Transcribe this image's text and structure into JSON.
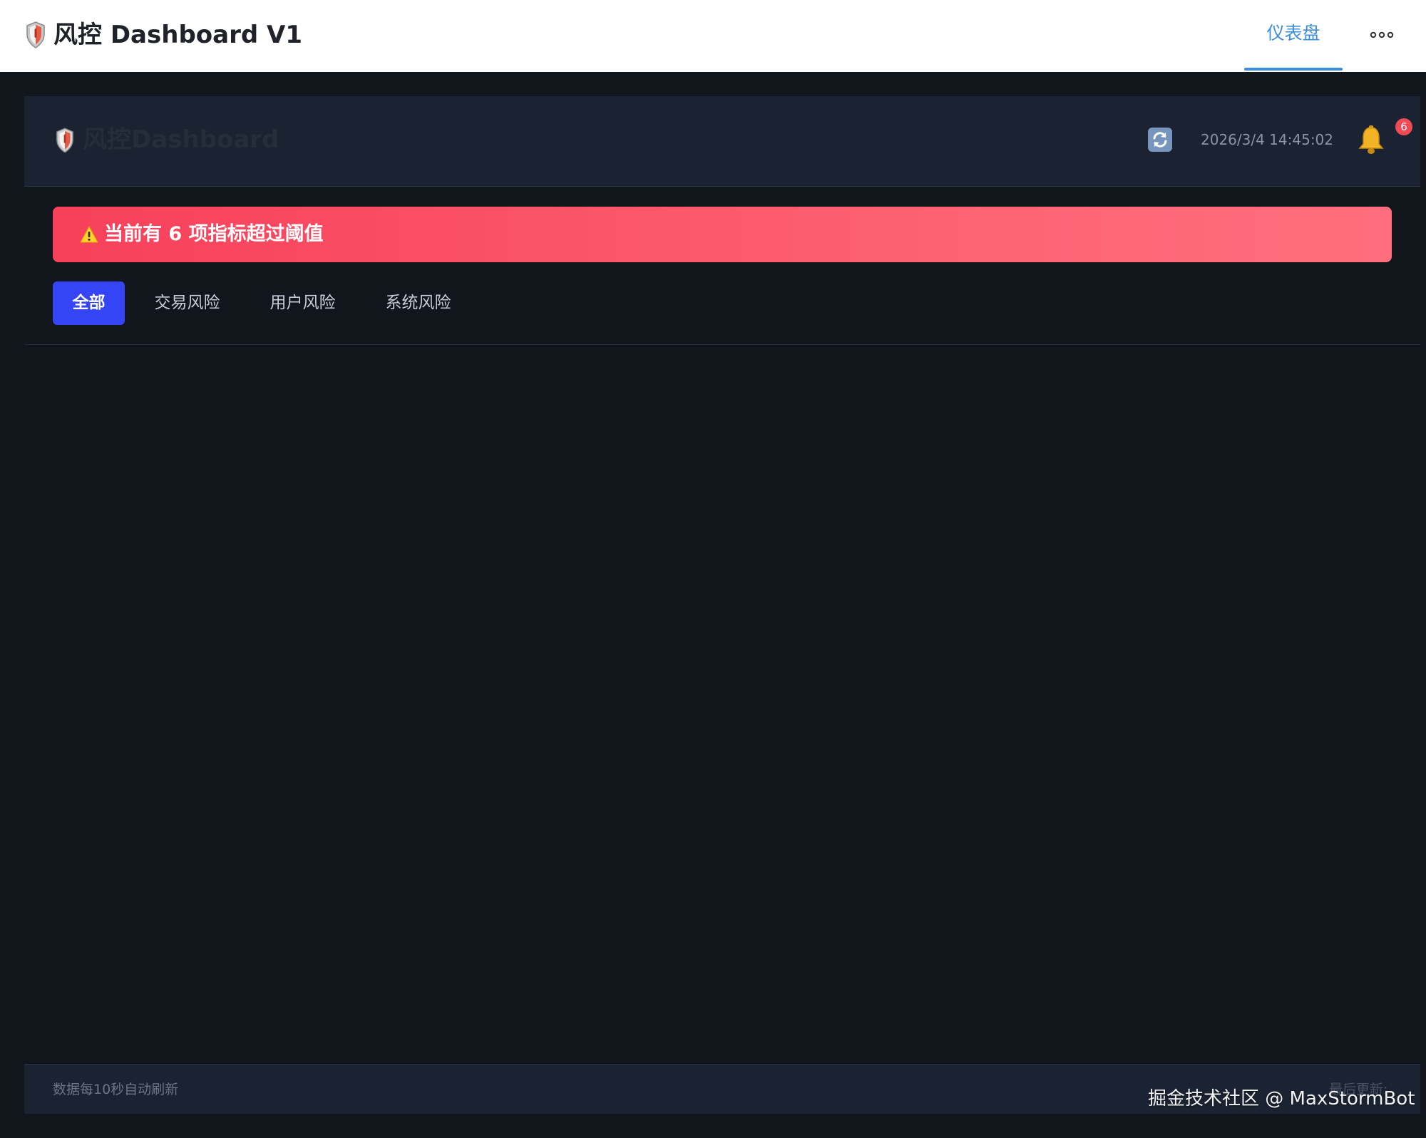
{
  "app_bar": {
    "title": "风控 Dashboard V1",
    "nav_tab_label": "仪表盘",
    "accent_color": "#3d8fdc",
    "app_icon": "shield-icon",
    "more_icon": "ellipsis-icon"
  },
  "dashboard": {
    "header": {
      "brand_title": "风控Dashboard",
      "brand_icon": "shield-icon",
      "refresh_icon": "refresh-icon",
      "datetime": "2026/3/4 14:45:02",
      "bell_icon": "bell-icon",
      "notification_count": "6"
    },
    "alert": {
      "icon": "warning-icon",
      "text": "当前有 6 项指标超过阈值",
      "color": "#f7405a"
    },
    "filter_tabs": [
      {
        "label": "全部",
        "active": true
      },
      {
        "label": "交易风险",
        "active": false
      },
      {
        "label": "用户风险",
        "active": false
      },
      {
        "label": "系统风险",
        "active": false
      }
    ],
    "active_tab_color": "#3544f5",
    "footer": {
      "left_text": "数据每10秒自动刷新",
      "right_text": "最后更新:"
    }
  },
  "watermark": "掘金技术社区 @ MaxStormBot"
}
